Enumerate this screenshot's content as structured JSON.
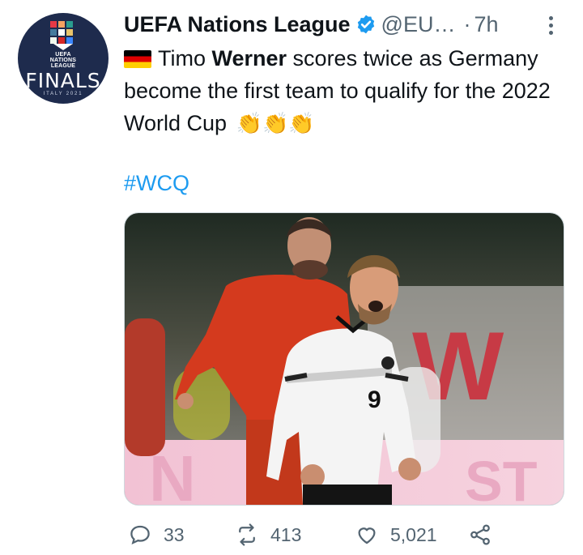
{
  "account": {
    "name": "UEFA Nations League",
    "handle": "@EU…",
    "separator": "·",
    "time": "7h",
    "avatar_text": {
      "line1": "UEFA",
      "line2": "NATIONS",
      "line3": "LEAGUE",
      "finals": "FINALS",
      "italy": "ITALY 2021"
    }
  },
  "tweet": {
    "text_before": "Timo ",
    "text_bold": "Werner",
    "text_after": " scores twice as Germany become the first team to qualify for the 2022 World Cup",
    "claps": "👏👏👏",
    "hashtag": "#WCQ"
  },
  "photo": {
    "jersey_number": "9",
    "bg_letters_1": "W",
    "bg_letters_2": "N",
    "bg_letters_3": "ST"
  },
  "actions": {
    "replies": "33",
    "retweets": "413",
    "likes": "5,021"
  },
  "colors": {
    "link": "#1d9bf0",
    "muted": "#536471",
    "verified": "#1d9bf0",
    "avatar_bg": "#1e2b4d"
  },
  "icons": [
    "verified-badge-icon",
    "more-icon",
    "reply-icon",
    "retweet-icon",
    "like-icon",
    "share-icon",
    "germany-flag-icon"
  ]
}
